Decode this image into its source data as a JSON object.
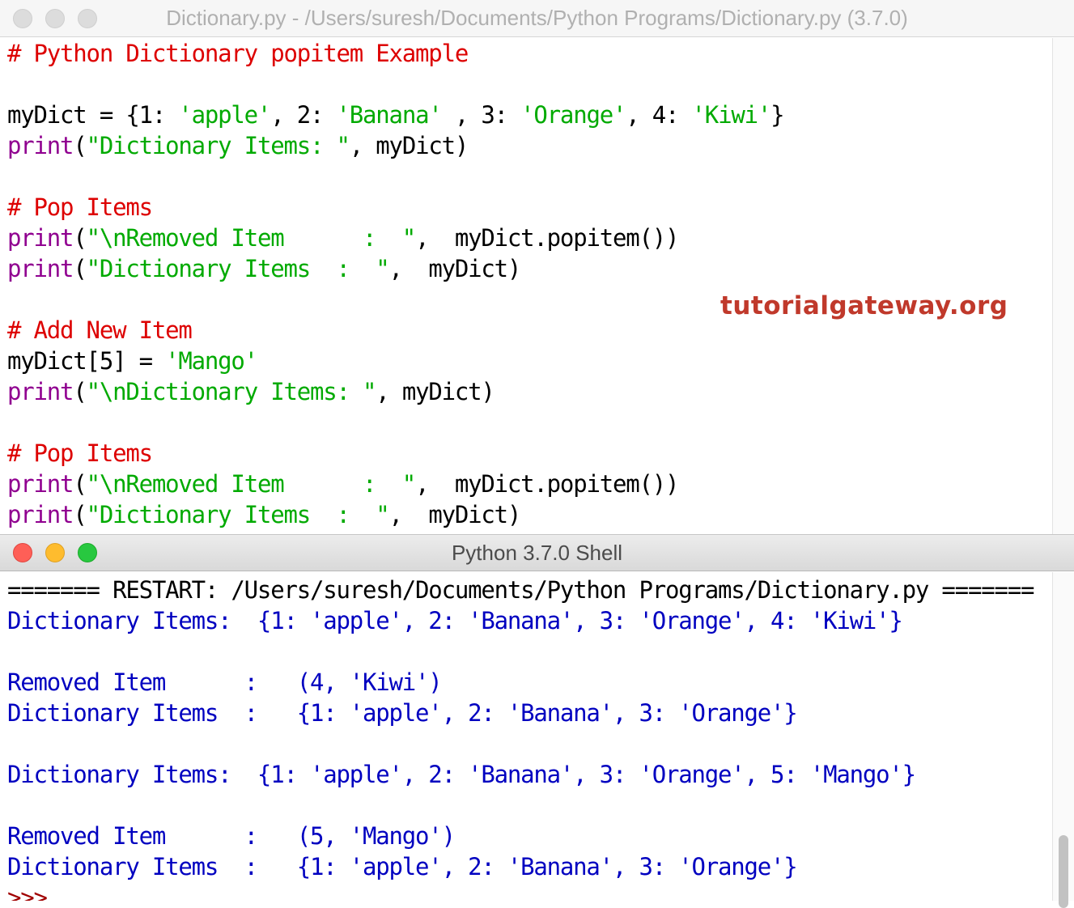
{
  "editor": {
    "window_title": "Dictionary.py - /Users/suresh/Documents/Python Programs/Dictionary.py (3.7.0)",
    "lines": {
      "l1": "# Python Dictionary popitem Example",
      "l3a": "myDict = {1: ",
      "l3b": "'apple'",
      "l3c": ", 2: ",
      "l3d": "'Banana'",
      "l3e": " , 3: ",
      "l3f": "'Orange'",
      "l3g": ", 4: ",
      "l3h": "'Kiwi'",
      "l3i": "}",
      "l4a": "print",
      "l4b": "(",
      "l4c": "\"Dictionary Items: \"",
      "l4d": ", myDict)",
      "l6": "# Pop Items",
      "l7a": "print",
      "l7b": "(",
      "l7c": "\"\\nRemoved Item      :  \"",
      "l7d": ",  myDict.popitem())",
      "l8a": "print",
      "l8b": "(",
      "l8c": "\"Dictionary Items  :  \"",
      "l8d": ",  myDict)",
      "l10": "# Add New Item",
      "l11a": "myDict[5] = ",
      "l11b": "'Mango'",
      "l12a": "print",
      "l12b": "(",
      "l12c": "\"\\nDictionary Items: \"",
      "l12d": ", myDict)",
      "l14": "# Pop Items",
      "l15a": "print",
      "l15b": "(",
      "l15c": "\"\\nRemoved Item      :  \"",
      "l15d": ",  myDict.popitem())",
      "l16a": "print",
      "l16b": "(",
      "l16c": "\"Dictionary Items  :  \"",
      "l16d": ",  myDict)"
    }
  },
  "watermark": "tutorialgateway.org",
  "shell": {
    "window_title": "Python 3.7.0 Shell",
    "restart_line": "======= RESTART: /Users/suresh/Documents/Python Programs/Dictionary.py =======",
    "output": [
      "Dictionary Items:  {1: 'apple', 2: 'Banana', 3: 'Orange', 4: 'Kiwi'}",
      "Removed Item      :   (4, 'Kiwi')",
      "Dictionary Items  :   {1: 'apple', 2: 'Banana', 3: 'Orange'}",
      "Dictionary Items:  {1: 'apple', 2: 'Banana', 3: 'Orange', 5: 'Mango'}",
      "Removed Item      :   (5, 'Mango')",
      "Dictionary Items  :   {1: 'apple', 2: 'Banana', 3: 'Orange'}"
    ],
    "prompt": ">>>"
  },
  "colors": {
    "comment": "#dd0000",
    "keyword": "#900090",
    "string": "#00aa00",
    "output": "#0000c0",
    "prompt": "#a00000",
    "watermark": "#c0392b"
  }
}
